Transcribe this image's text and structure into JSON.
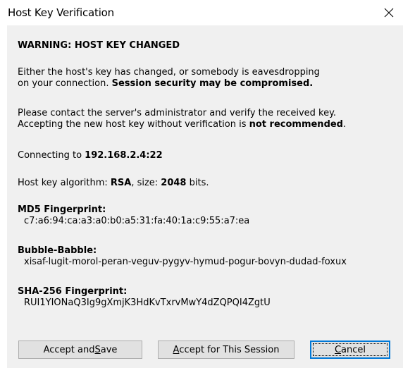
{
  "window": {
    "title": "Host Key Verification",
    "close_icon": "close-icon"
  },
  "warning": {
    "heading": "WARNING: HOST KEY CHANGED",
    "para1_line1": "Either the host's key has changed, or somebody is eavesdropping",
    "para1_line2_prefix": "on your connection. ",
    "para1_line2_bold": "Session security may be compromised.",
    "para2_line1": "Please contact the server's administrator and verify the received key.",
    "para2_line2_prefix": "Accepting the new host key without verification is ",
    "para2_line2_bold": "not recommended",
    "para2_line2_suffix": "."
  },
  "connection": {
    "prefix": "Connecting to ",
    "address": "192.168.2.4:22"
  },
  "algorithm": {
    "prefix": "Host key algorithm: ",
    "name": "RSA",
    "size_prefix": ", size: ",
    "size": "2048",
    "size_suffix": " bits."
  },
  "fingerprints": {
    "md5_label": "MD5 Fingerprint:",
    "md5_value": "c7:a6:94:ca:a3:a0:b0:a5:31:fa:40:1a:c9:55:a7:ea",
    "bubble_label": "Bubble-Babble:",
    "bubble_value": "xisaf-lugit-morol-peran-veguv-pygyv-hymud-pogur-bovyn-dudad-foxux",
    "sha_label": "SHA-256 Fingerprint:",
    "sha_value": "RUI1YIONaQ3Ig9gXmjK3HdKvTxrvMwY4dZQPQI4ZgtU"
  },
  "buttons": {
    "accept_save_prefix": "Accept and ",
    "accept_save_mnemonic": "S",
    "accept_save_suffix": "ave",
    "accept_session_mnemonic": "A",
    "accept_session_suffix": "ccept for This Session",
    "cancel_mnemonic": "C",
    "cancel_suffix": "ancel"
  }
}
